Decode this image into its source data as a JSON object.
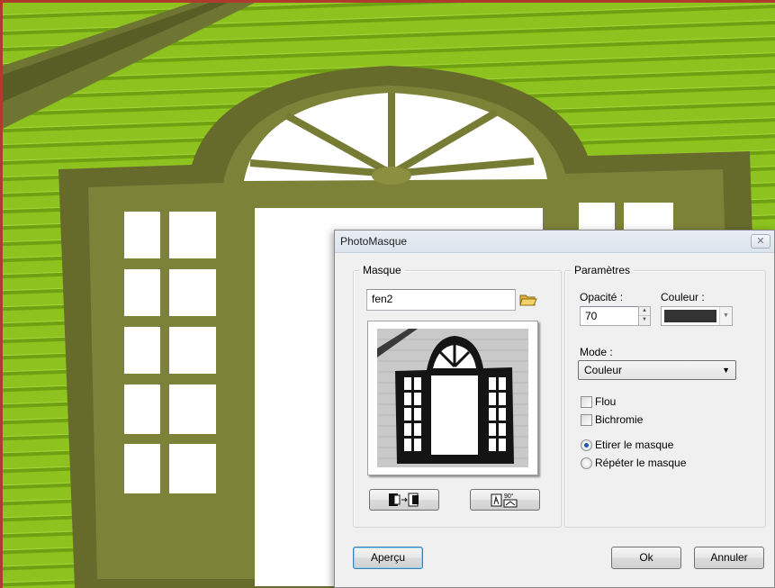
{
  "background": {
    "colors": {
      "siding": "#8dc21f",
      "trim": "#666b2c",
      "border": "#b03a2e"
    }
  },
  "dialog": {
    "title": "PhotoMasque",
    "close_icon": "close-icon",
    "masque": {
      "group_label": "Masque",
      "name_value": "fen2",
      "browse_icon": "folder-open-icon",
      "flip_icon": "flip-horizontal-icon",
      "rotate_icon": "rotate-90-icon",
      "rotate_caption": "90°"
    },
    "parametres": {
      "group_label": "Paramètres",
      "opacity_label": "Opacité :",
      "opacity_value": "70",
      "color_label": "Couleur :",
      "color_value": "#333333",
      "mode_label": "Mode :",
      "mode_value": "Couleur",
      "flou_label": "Flou",
      "flou_checked": false,
      "bichromie_label": "Bichromie",
      "bichromie_checked": false,
      "etirer_label": "Etirer le masque",
      "etirer_selected": true,
      "repeter_label": "Répéter le masque",
      "repeter_selected": false
    },
    "buttons": {
      "apercu": "Aperçu",
      "ok": "Ok",
      "annuler": "Annuler"
    }
  }
}
